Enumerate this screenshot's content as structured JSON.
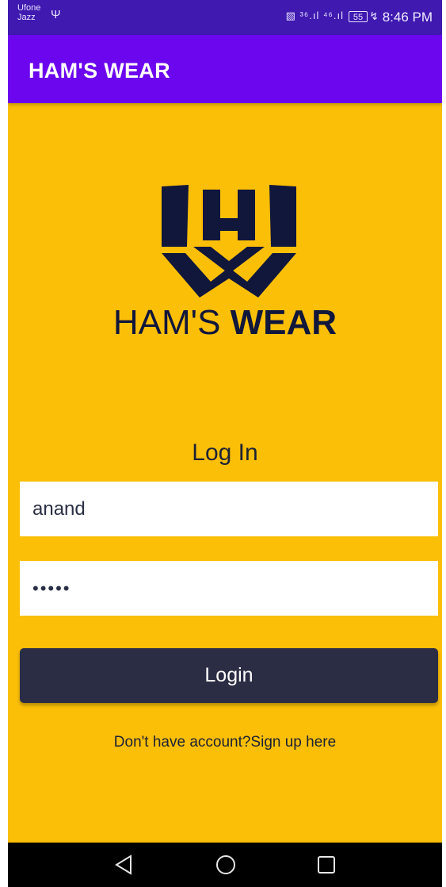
{
  "status_bar": {
    "carrier_1": "Ufone",
    "carrier_2": "Jazz",
    "usb_icon": "usb-icon",
    "signal_icons": "⋪▊ ³⁶▖▗▘ ⁴⁶▖▗▘",
    "battery": "55",
    "charge_icon": "ϟ",
    "time": "8:46 PM"
  },
  "app_bar": {
    "title": "HAM'S WEAR"
  },
  "logo": {
    "brand_light": "HAM'S ",
    "brand_bold": "WEAR"
  },
  "form": {
    "title": "Log In",
    "username_value": "anand",
    "password_value": "•••••",
    "login_label": "Login",
    "signup_text": "Don't have account?Sign up here"
  },
  "nav_bar": {
    "icons": [
      "back-icon",
      "home-icon",
      "recents-icon"
    ]
  },
  "colors": {
    "background": "#fbbf08",
    "app_bar": "#6b06ee",
    "status_bar": "#3f19b0",
    "button": "#2b2d44",
    "logo": "#11163b"
  }
}
